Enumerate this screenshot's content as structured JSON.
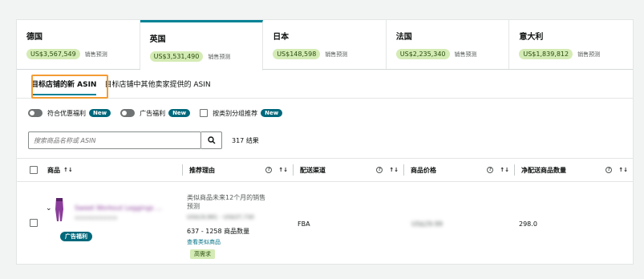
{
  "markets": [
    {
      "name": "德国",
      "amount": "US$3,567,549",
      "label": "销售预测",
      "active": false
    },
    {
      "name": "英国",
      "amount": "US$3,531,490",
      "label": "销售预测",
      "active": true
    },
    {
      "name": "日本",
      "amount": "US$148,598",
      "label": "销售预测",
      "active": false
    },
    {
      "name": "法国",
      "amount": "US$2,235,340",
      "label": "销售预测",
      "active": false
    },
    {
      "name": "意大利",
      "amount": "US$1,839,812",
      "label": "销售预测",
      "active": false
    }
  ],
  "subtabs": {
    "target": "目标店铺的新 ASIN",
    "other": "目标店铺中其他卖家提供的 ASIN"
  },
  "filters": {
    "promo": "符合优惠福利",
    "ad": "广告福利",
    "group": "按类别分组推荐",
    "new": "New"
  },
  "search": {
    "placeholder": "搜索商品名称或 ASIN",
    "results": "317 结果"
  },
  "columns": {
    "product": "商品",
    "reason": "推荐理由",
    "channel": "配送渠道",
    "price": "商品价格",
    "quantity": "净配送商品数量"
  },
  "row": {
    "title": "Sweet Workout Leggings ...",
    "sku": "XXXXXXXXXXXXX",
    "ad_badge": "广告福利",
    "reason_line1": "类似商品未来12个月的销售",
    "reason_line2": "预测",
    "reason_blur": "US$19,981 - US$37,730",
    "qty_range": "637 - 1258 商品数量",
    "view_link": "查看类似商品",
    "demand": "高需求",
    "channel": "FBA",
    "price": "US$29.99",
    "quantity": "298.0"
  },
  "icons": {
    "search": "search-icon",
    "sort": "sort-icon",
    "help": "help-icon",
    "chevron": "chevron-down-icon"
  }
}
